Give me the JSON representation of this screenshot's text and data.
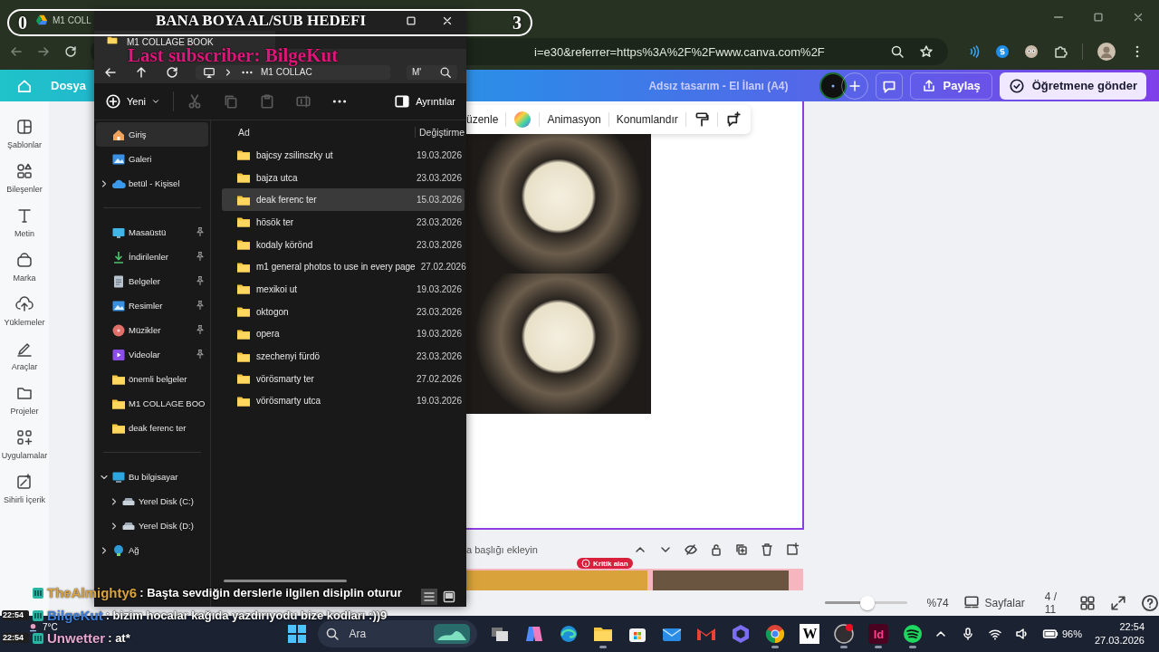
{
  "stream_overlay": {
    "goal_start": "0",
    "goal_title": "BANA BOYA AL/SUB HEDEFI",
    "goal_end": "3",
    "last_subscriber": "Last subscriber: BilgeKut"
  },
  "browser": {
    "tab_title": "M1 COLL",
    "address": "i=e30&referrer=https%3A%2F%2Fwww.canva.com%2F"
  },
  "canva": {
    "menu": "Dosya",
    "design_title": "Adsız tasarım - El İlanı (A4)",
    "share": "Paylaş",
    "send": "Öğretmene gönder",
    "sidebar": [
      {
        "label": "Şablonlar"
      },
      {
        "label": "Bileşenler"
      },
      {
        "label": "Metin"
      },
      {
        "label": "Marka"
      },
      {
        "label": "Yüklemeler"
      },
      {
        "label": "Araçlar"
      },
      {
        "label": "Projeler"
      },
      {
        "label": "Uygulamalar"
      },
      {
        "label": "Sihirli İçerik"
      }
    ],
    "element_toolbar": [
      {
        "kind": "text",
        "label": "üzenle"
      },
      {
        "kind": "color"
      },
      {
        "kind": "text",
        "label": "Animasyon"
      },
      {
        "kind": "text",
        "label": "Konumlandır"
      },
      {
        "kind": "paint"
      },
      {
        "kind": "comment"
      }
    ],
    "page_title_hint": "a başlığı ekleyin",
    "critical_badge": "Kritik alan",
    "zoom": {
      "level": 0.52,
      "reading": "%74"
    },
    "pages_button": "Sayfalar",
    "page_count": "4 / 11"
  },
  "explorer": {
    "tab_title": "M1 COLLAGE BOOK",
    "breadcrumb": "M1 COLLAC",
    "search_value": "M'",
    "new_button": "Yeni",
    "details_button": "Ayrıntılar",
    "nav_sections": [
      [
        {
          "label": "Giriş",
          "kind": "home",
          "selected": true
        },
        {
          "label": "Galeri",
          "kind": "gallery",
          "selected": false
        },
        {
          "label": "betül - Kişisel",
          "kind": "cloud",
          "selected": false,
          "expanded": false
        }
      ],
      [
        {
          "label": "Masaüstü",
          "kind": "desktop",
          "selected": false,
          "pinned": true
        },
        {
          "label": "İndirilenler",
          "kind": "download",
          "selected": false,
          "pinned": true
        },
        {
          "label": "Belgeler",
          "kind": "documents",
          "selected": false,
          "pinned": true
        },
        {
          "label": "Resimler",
          "kind": "pictures",
          "selected": false,
          "pinned": true
        },
        {
          "label": "Müzikler",
          "kind": "music",
          "selected": false,
          "pinned": true
        },
        {
          "label": "Videolar",
          "kind": "videos",
          "selected": false,
          "pinned": true
        },
        {
          "label": "önemli belgeler",
          "kind": "folder",
          "selected": false,
          "pinned": false
        },
        {
          "label": "M1 COLLAGE BOO",
          "kind": "folder",
          "selected": false,
          "pinned": false
        },
        {
          "label": "deak ferenc ter",
          "kind": "folder",
          "selected": false,
          "pinned": false
        }
      ],
      [
        {
          "label": "Bu bilgisayar",
          "kind": "pc",
          "selected": false,
          "expanded": true,
          "children": [
            {
              "label": "Yerel Disk (C:)",
              "kind": "disk",
              "selected": false,
              "expanded": false
            },
            {
              "label": "Yerel Disk (D:)",
              "kind": "disk",
              "selected": false,
              "expanded": false
            }
          ]
        },
        {
          "label": "Ağ",
          "kind": "network",
          "selected": false,
          "expanded": false
        }
      ]
    ],
    "columns": [
      "Ad",
      "Değiştirme"
    ],
    "rows": [
      {
        "name": "bajcsy zsilinszky ut",
        "date": "19.03.2026",
        "selected": false
      },
      {
        "name": "bajza utca",
        "date": "23.03.2026",
        "selected": false
      },
      {
        "name": "deak ferenc ter",
        "date": "15.03.2026",
        "selected": true
      },
      {
        "name": "hösök ter",
        "date": "23.03.2026",
        "selected": false
      },
      {
        "name": "kodaly körönd",
        "date": "23.03.2026",
        "selected": false
      },
      {
        "name": "m1 general photos to use in every page",
        "date": "27.02.2026",
        "selected": false
      },
      {
        "name": "mexikoi ut",
        "date": "19.03.2026",
        "selected": false
      },
      {
        "name": "oktogon",
        "date": "23.03.2026",
        "selected": false
      },
      {
        "name": "opera",
        "date": "19.03.2026",
        "selected": false
      },
      {
        "name": "szechenyi fürdö",
        "date": "23.03.2026",
        "selected": false
      },
      {
        "name": "vörösmarty ter",
        "date": "27.02.2026",
        "selected": false
      },
      {
        "name": "vörösmarty utca",
        "date": "19.03.2026",
        "selected": false
      }
    ]
  },
  "chat": [
    {
      "user": "TheAlmighty6",
      "color": "#d9a441",
      "text": ": Başta sevdiğin derslerle ilgilen disiplin oturur"
    },
    {
      "time": "22:54",
      "user": "BilgeKut",
      "color": "#3f7fd8",
      "text": ": bizim hocalar kağıda yazdırıyodu bize kodları :))9"
    },
    {
      "time": "22:54",
      "user": "Unwetter",
      "color": "#e7a6cf",
      "text": ": at*"
    }
  ],
  "taskbar": {
    "weather": "7°C",
    "search": "Ara",
    "battery": "96%",
    "time": "22:54",
    "date": "27.03.2026",
    "apps": [
      {
        "kind": "taskview",
        "running": false
      },
      {
        "kind": "copilot",
        "running": false
      },
      {
        "kind": "edge",
        "running": false
      },
      {
        "kind": "explorer",
        "running": true
      },
      {
        "kind": "store",
        "running": false
      },
      {
        "kind": "outlook",
        "running": false
      },
      {
        "kind": "gmail",
        "running": false
      },
      {
        "kind": "bing",
        "running": false
      },
      {
        "kind": "chrome",
        "running": true
      },
      {
        "kind": "wiki",
        "label": "W",
        "running": false
      },
      {
        "kind": "obs",
        "running": true
      },
      {
        "kind": "indesign",
        "label": "Id",
        "running": true
      },
      {
        "kind": "spotify",
        "running": true
      }
    ]
  }
}
